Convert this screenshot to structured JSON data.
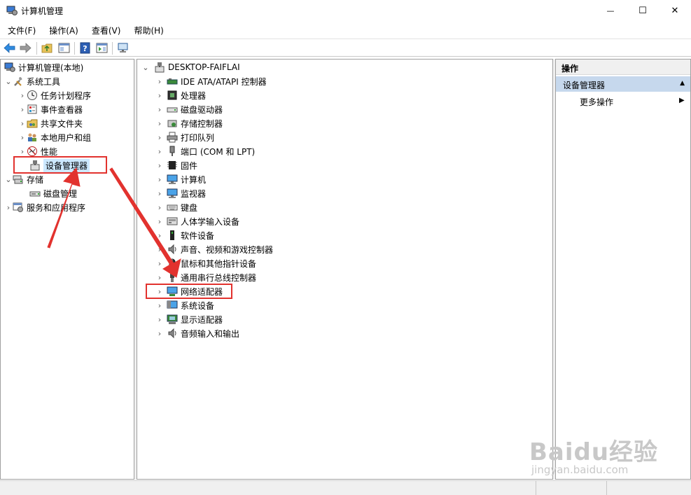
{
  "window": {
    "title": "计算机管理",
    "minimize_glyph": "—",
    "maximize_glyph": "☐",
    "close_glyph": "✕"
  },
  "menubar": [
    {
      "label": "文件(F)"
    },
    {
      "label": "操作(A)"
    },
    {
      "label": "查看(V)"
    },
    {
      "label": "帮助(H)"
    }
  ],
  "toolbar": {
    "buttons": [
      "back-arrow-icon",
      "forward-arrow-icon",
      "up-folder-icon",
      "show-hide-tree-icon",
      "help-icon",
      "show-action-pane-icon",
      "monitor-icon"
    ]
  },
  "left_tree": {
    "root": "计算机管理(本地)",
    "system_tools": "系统工具",
    "task_scheduler": "任务计划程序",
    "event_viewer": "事件查看器",
    "shared_folders": "共享文件夹",
    "local_users": "本地用户和组",
    "performance": "性能",
    "device_manager": "设备管理器",
    "storage": "存储",
    "disk_management": "磁盘管理",
    "services_apps": "服务和应用程序"
  },
  "device_tree": {
    "computer_name": "DESKTOP-FAIFLAI",
    "categories": [
      {
        "label": "IDE ATA/ATAPI 控制器",
        "icon": "ide-controller-icon"
      },
      {
        "label": "处理器",
        "icon": "processor-icon"
      },
      {
        "label": "磁盘驱动器",
        "icon": "disk-drive-icon"
      },
      {
        "label": "存储控制器",
        "icon": "storage-controller-icon"
      },
      {
        "label": "打印队列",
        "icon": "printer-icon"
      },
      {
        "label": "端口 (COM 和 LPT)",
        "icon": "port-icon"
      },
      {
        "label": "固件",
        "icon": "firmware-icon"
      },
      {
        "label": "计算机",
        "icon": "computer-icon"
      },
      {
        "label": "监视器",
        "icon": "monitor-icon"
      },
      {
        "label": "键盘",
        "icon": "keyboard-icon"
      },
      {
        "label": "人体学输入设备",
        "icon": "hid-icon"
      },
      {
        "label": "软件设备",
        "icon": "software-device-icon"
      },
      {
        "label": "声音、视频和游戏控制器",
        "icon": "speaker-icon"
      },
      {
        "label": "鼠标和其他指针设备",
        "icon": "mouse-icon"
      },
      {
        "label": "通用串行总线控制器",
        "icon": "usb-icon"
      },
      {
        "label": "网络适配器",
        "icon": "network-adapter-icon"
      },
      {
        "label": "系统设备",
        "icon": "system-device-icon"
      },
      {
        "label": "显示适配器",
        "icon": "display-adapter-icon"
      },
      {
        "label": "音频输入和输出",
        "icon": "audio-io-icon"
      }
    ]
  },
  "actions_pane": {
    "header": "操作",
    "section": "设备管理器",
    "more_actions": "更多操作"
  },
  "watermark": {
    "logo": "Baidu经验",
    "domain": "jingyan.baidu.com"
  },
  "colors": {
    "highlight": "#e2322e",
    "selection": "#cce8ff",
    "section_bg": "#c6d8ed"
  }
}
